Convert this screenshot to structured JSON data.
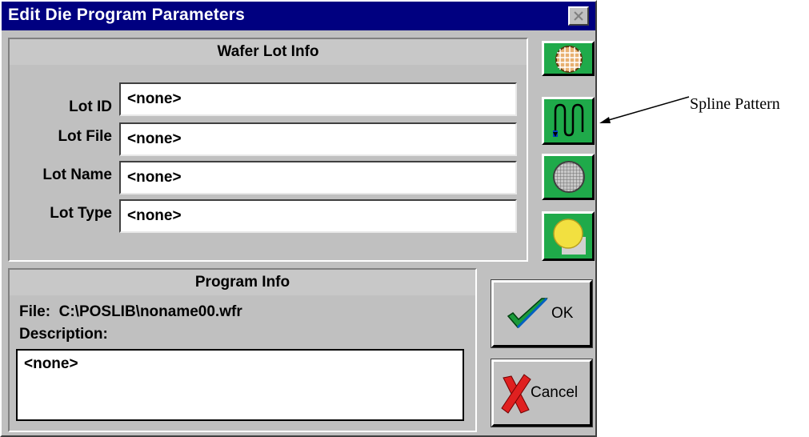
{
  "window": {
    "title": "Edit Die Program Parameters",
    "close_icon": "close-x-icon"
  },
  "wafer_lot": {
    "header": "Wafer Lot Info",
    "fields": [
      {
        "label": "Lot ID",
        "value": "<none>"
      },
      {
        "label": "Lot File",
        "value": "<none>"
      },
      {
        "label": "Lot Name",
        "value": "<none>"
      },
      {
        "label": "Lot Type",
        "value": "<none>"
      }
    ]
  },
  "tool_buttons": [
    {
      "icon": "wafer-grid-icon"
    },
    {
      "icon": "spline-pattern-icon"
    },
    {
      "icon": "wafer-mesh-icon"
    },
    {
      "icon": "wafer-yellow-icon"
    }
  ],
  "program_info": {
    "header": "Program Info",
    "file_line": "File:  C:\\POSLIB\\noname00.wfr",
    "description_label": "Description:",
    "description_value": "<none>"
  },
  "buttons": {
    "ok_label": "OK",
    "ok_icon": "checkmark-icon",
    "cancel_label": "Cancel",
    "cancel_icon": "red-x-icon"
  },
  "annotation": {
    "text": "Spline Pattern"
  },
  "colors": {
    "titlebar": "#000080",
    "dialog_bg": "#c0c0c0",
    "tool_button_bg": "#1faa4a"
  }
}
